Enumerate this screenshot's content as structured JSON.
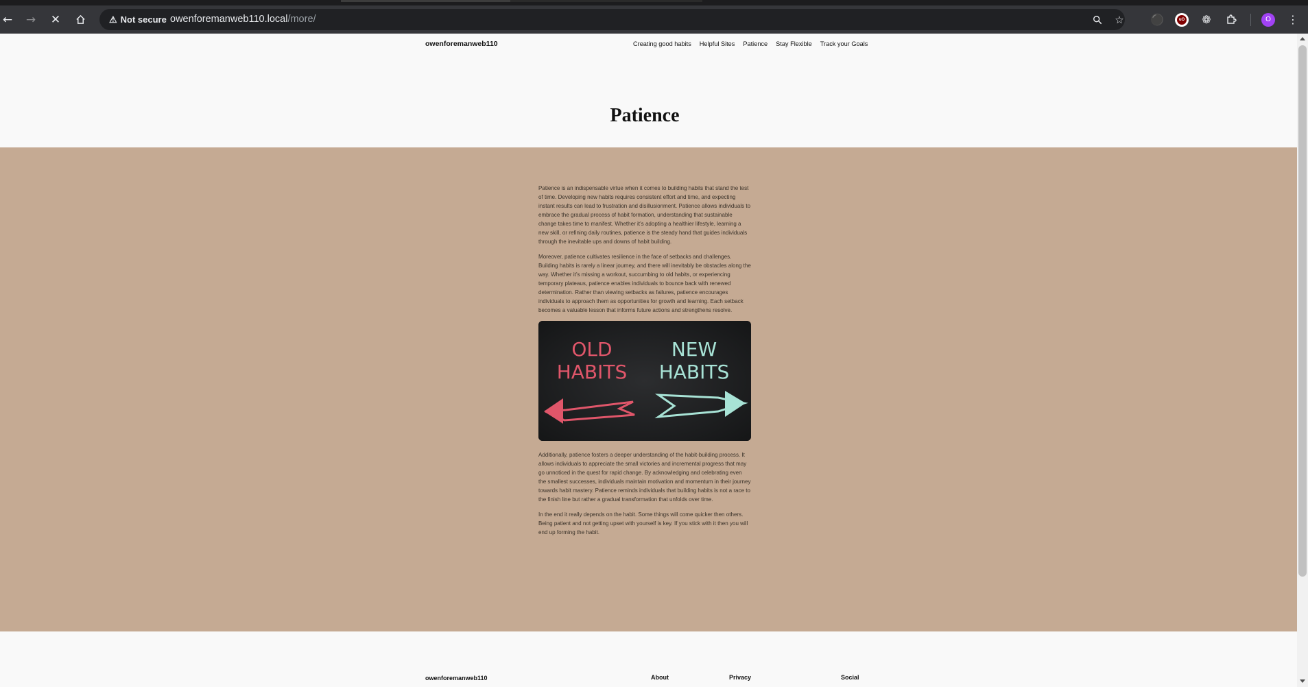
{
  "browser": {
    "security_label": "Not secure",
    "url_host": "owenforemanweb110.local",
    "url_path": "/more/",
    "profile_initial": "O"
  },
  "site": {
    "title": "owenforemanweb110",
    "nav": [
      "Creating good habits",
      "Helpful Sites",
      "Patience",
      "Stay Flexible",
      "Track your Goals"
    ]
  },
  "page": {
    "title": "Patience",
    "paragraphs_top": [
      "Patience is an indispensable virtue when it comes to building habits that stand the test of time. Developing new habits requires consistent effort and time, and expecting instant results can lead to frustration and disillusionment. Patience allows individuals to embrace the gradual process of habit formation, understanding that sustainable change takes time to manifest. Whether it’s adopting a healthier lifestyle, learning a new skill, or refining daily routines, patience is the steady hand that guides individuals through the inevitable ups and downs of habit building.",
      "Moreover, patience cultivates resilience in the face of setbacks and challenges. Building habits is rarely a linear journey, and there will inevitably be obstacles along the way. Whether it’s missing a workout, succumbing to old habits, or experiencing temporary plateaus, patience enables individuals to bounce back with renewed determination. Rather than viewing setbacks as failures, patience encourages individuals to approach them as opportunities for growth and learning. Each setback becomes a valuable lesson that informs future actions and strengthens resolve."
    ],
    "image": {
      "left_text_line1": "OLD",
      "left_text_line2": "HABITS",
      "right_text_line1": "NEW",
      "right_text_line2": "HABITS",
      "left_color": "#e0566a",
      "right_color": "#a8e3d6"
    },
    "paragraphs_bottom": [
      "Additionally, patience fosters a deeper understanding of the habit-building process. It allows individuals to appreciate the small victories and incremental progress that may go unnoticed in the quest for rapid change. By acknowledging and celebrating even the smallest successes, individuals maintain motivation and momentum in their journey towards habit mastery. Patience reminds individuals that building habits is not a race to the finish line but rather a gradual transformation that unfolds over time.",
      "In the end it really depends on the habit. Some things will come quicker then others. Being patient and not getting upset with yourself is key. If you stick with it then you will end up forming the habit."
    ]
  },
  "footer": {
    "title": "owenforemanweb110",
    "links": [
      "About",
      "Privacy",
      "Social"
    ]
  },
  "colors": {
    "content_band": "#c5aa93",
    "page_background": "#f9f9f9"
  }
}
